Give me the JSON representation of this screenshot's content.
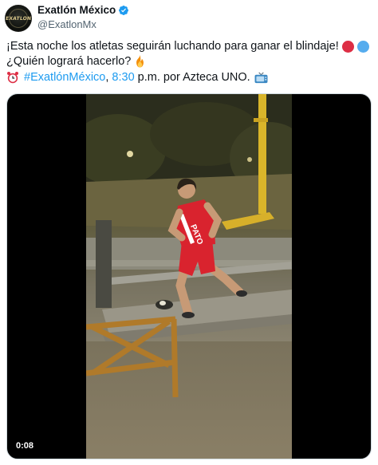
{
  "account": {
    "display_name": "Exatlón México",
    "handle": "@ExatlonMx",
    "avatar_text": "EXATLON"
  },
  "tweet": {
    "line1_text": "¡Esta noche los atletas seguirán luchando para ganar el blindaje!",
    "line2_text": "¿Quién logrará hacerlo?",
    "line3_hashtag": "#ExatlónMéxico",
    "line3_sep": ", ",
    "line3_time": "8:30",
    "line3_rest": " p.m. por Azteca UNO."
  },
  "media": {
    "timestamp": "0:08",
    "jersey_text": "PATO"
  },
  "colors": {
    "link": "#1d9bf0",
    "verified": "#1d9bf0",
    "red_team": "#dd2e44",
    "blue_team": "#55acee",
    "jersey": "#d9232e"
  },
  "icons": [
    "verified-badge-icon",
    "red-circle-icon",
    "blue-circle-icon",
    "fire-icon",
    "alarm-clock-icon",
    "television-icon"
  ]
}
